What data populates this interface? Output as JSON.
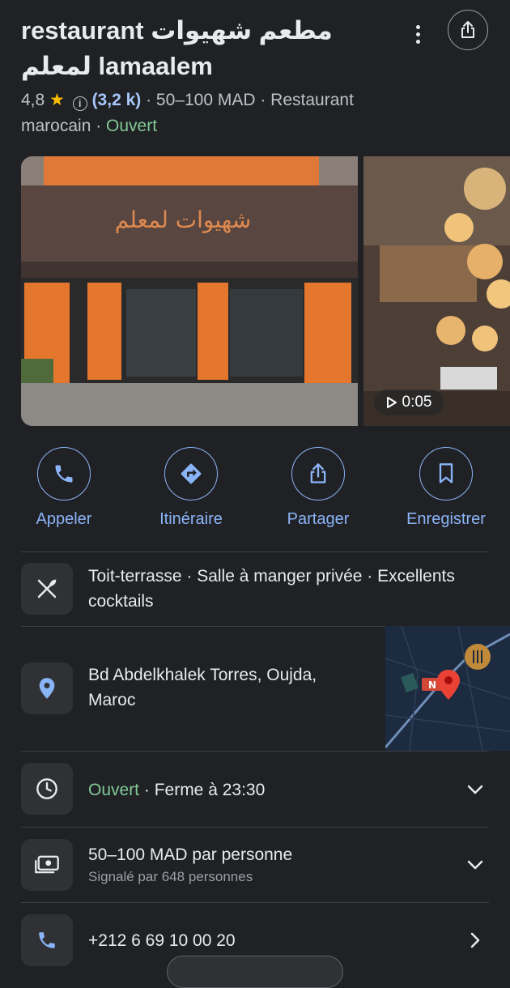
{
  "header": {
    "title": "restaurant مطعم شهيوات لمعلم lamaalem",
    "rating": "4,8",
    "reviews": "(3,2 k)",
    "price_range": "· 50–100 MAD · Restaurant",
    "category_cont": "marocain",
    "status": "Ouvert"
  },
  "photos": {
    "video_duration": "0:05"
  },
  "actions": [
    {
      "label": "Appeler",
      "icon": "phone-icon"
    },
    {
      "label": "Itinéraire",
      "icon": "directions-icon"
    },
    {
      "label": "Partager",
      "icon": "share-icon"
    },
    {
      "label": "Enregistrer",
      "icon": "bookmark-icon"
    }
  ],
  "details": {
    "highlights_line1": "Toit-terrasse · Salle à manger privée · Excellents",
    "highlights_line2": "cocktails",
    "address_line1": "Bd Abdelkhalek Torres, Oujda,",
    "address_line2": "Maroc",
    "hours_status": "Ouvert",
    "hours_close": " · Ferme à 23:30",
    "price_per_person": "50–100 MAD par personne",
    "price_reported": "Signalé par 648 personnes",
    "phone": "+212 6 69 10 00 20"
  },
  "colors": {
    "background": "#202124",
    "accent": "#8ab4f8",
    "open": "#81c995",
    "star": "#fbbc04"
  }
}
